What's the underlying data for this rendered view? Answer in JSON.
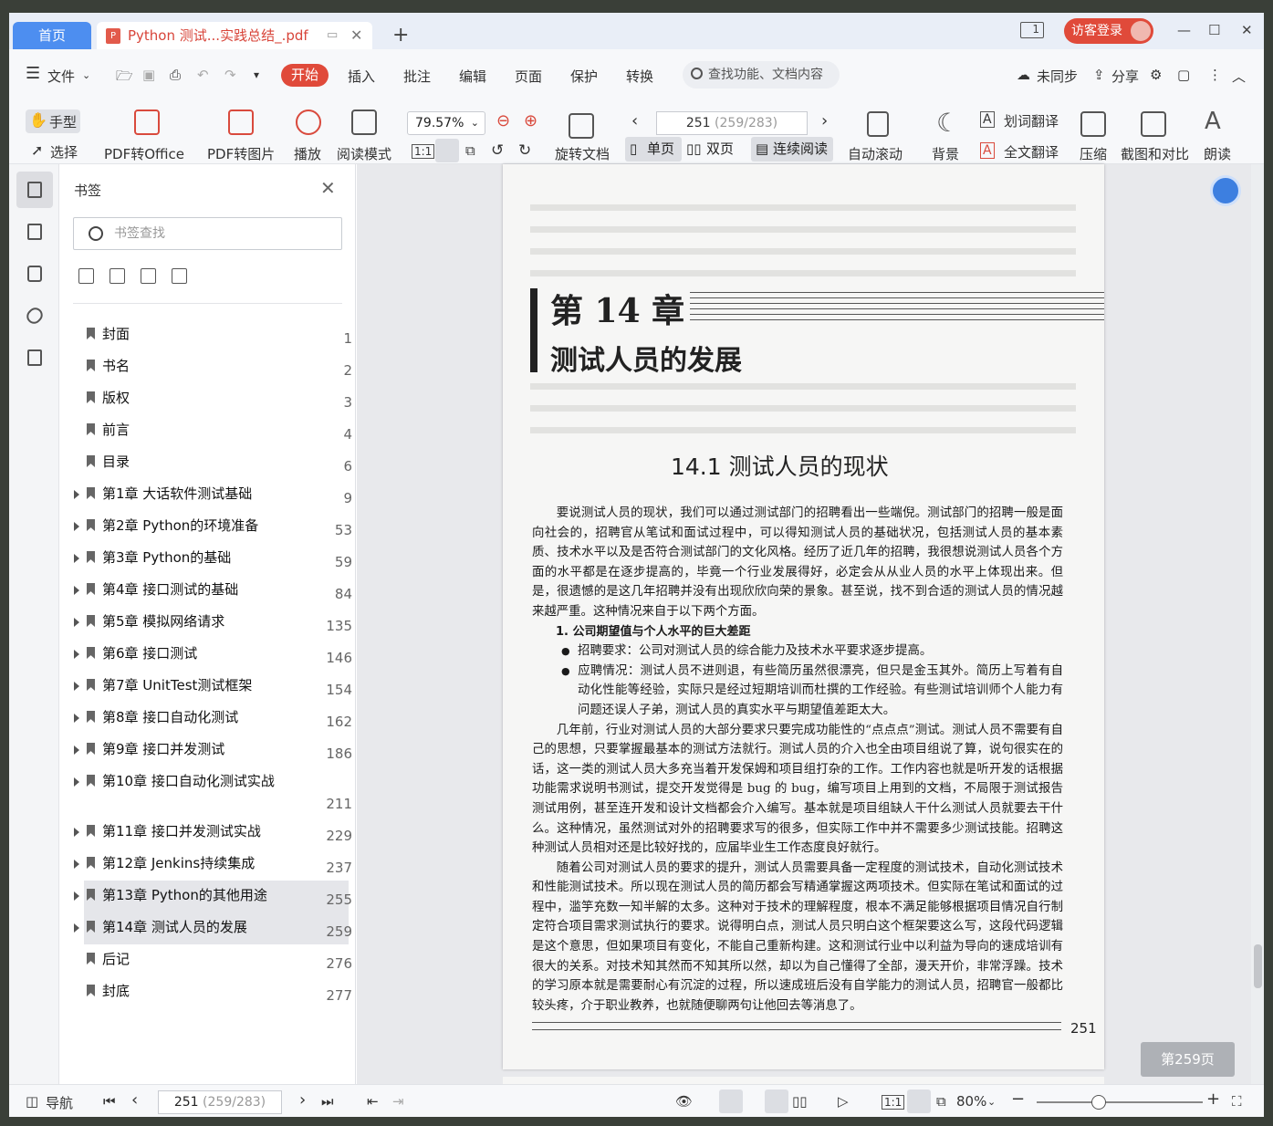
{
  "tabs": {
    "home": "首页",
    "doc_title": "Python 测试...实践总结_.pdf",
    "new_tab": "+"
  },
  "titlebar": {
    "pages_icon": "1",
    "login": "访客登录",
    "minimize": "—",
    "maximize": "☐",
    "close": "✕"
  },
  "menu": {
    "file": "文件",
    "items": [
      "开始",
      "插入",
      "批注",
      "编辑",
      "页面",
      "保护",
      "转换"
    ],
    "search": "查找功能、文档内容",
    "sync": "未同步",
    "share": "分享"
  },
  "toolbar": {
    "hand": "手型",
    "select": "选择",
    "pdf_office": "PDF转Office",
    "pdf_image": "PDF转图片",
    "play": "播放",
    "read_mode": "阅读模式",
    "zoom": "79.57%",
    "page_current": "251",
    "page_total": "(259/283)",
    "rotate": "旋转文档",
    "single": "单页",
    "double": "双页",
    "continuous": "连续阅读",
    "auto_scroll": "自动滚动",
    "background": "背景",
    "word_translate": "划词翻译",
    "full_translate": "全文翻译",
    "compress": "压缩",
    "screenshot": "截图和对比",
    "read_aloud": "朗读"
  },
  "bookmarks": {
    "title": "书签",
    "search_placeholder": "书签查找",
    "items": [
      {
        "label": "封面",
        "page": "1",
        "expandable": false
      },
      {
        "label": "书名",
        "page": "2",
        "expandable": false
      },
      {
        "label": "版权",
        "page": "3",
        "expandable": false
      },
      {
        "label": "前言",
        "page": "4",
        "expandable": false
      },
      {
        "label": "目录",
        "page": "6",
        "expandable": false
      },
      {
        "label": "第1章  大话软件测试基础",
        "page": "9",
        "expandable": true
      },
      {
        "label": "第2章  Python的环境准备",
        "page": "53",
        "expandable": true
      },
      {
        "label": "第3章  Python的基础",
        "page": "59",
        "expandable": true
      },
      {
        "label": "第4章  接口测试的基础",
        "page": "84",
        "expandable": true
      },
      {
        "label": "第5章  模拟网络请求",
        "page": "135",
        "expandable": true
      },
      {
        "label": "第6章  接口测试",
        "page": "146",
        "expandable": true
      },
      {
        "label": "第7章  UnitTest测试框架",
        "page": "154",
        "expandable": true
      },
      {
        "label": "第8章  接口自动化测试",
        "page": "162",
        "expandable": true
      },
      {
        "label": "第9章  接口并发测试",
        "page": "186",
        "expandable": true
      },
      {
        "label": "第10章  接口自动化测试实战",
        "page": "211",
        "expandable": true
      },
      {
        "label": "第11章  接口并发测试实战",
        "page": "229",
        "expandable": true
      },
      {
        "label": "第12章  Jenkins持续集成",
        "page": "237",
        "expandable": true
      },
      {
        "label": "第13章  Python的其他用途",
        "page": "255",
        "expandable": true
      },
      {
        "label": "第14章  测试人员的发展",
        "page": "259",
        "expandable": true
      },
      {
        "label": "后记",
        "page": "276",
        "expandable": false
      },
      {
        "label": "封底",
        "page": "277",
        "expandable": false
      }
    ]
  },
  "document": {
    "chapter_no": "第 14 章",
    "chapter_title": "测试人员的发展",
    "section": "14.1   测试人员的现状",
    "para1": "要说测试人员的现状，我们可以通过测试部门的招聘看出一些端倪。测试部门的招聘一般是面向社会的，招聘官从笔试和面试过程中，可以得知测试人员的基础状况，包括测试人员的基本素质、技术水平以及是否符合测试部门的文化风格。经历了近几年的招聘，我很想说测试人员各个方面的水平都是在逐步提高的，毕竟一个行业发展得好，必定会从从业人员的水平上体现出来。但是，很遗憾的是这几年招聘并没有出现欣欣向荣的景象。甚至说，找不到合适的测试人员的情况越来越严重。这种情况来自于以下两个方面。",
    "heading1": "1. 公司期望值与个人水平的巨大差距",
    "bullet1": "招聘要求：公司对测试人员的综合能力及技术水平要求逐步提高。",
    "bullet2": "应聘情况：测试人员不进则退，有些简历虽然很漂亮，但只是金玉其外。简历上写着有自动化性能等经验，实际只是经过短期培训而杜撰的工作经验。有些测试培训师个人能力有问题还误人子弟，测试人员的真实水平与期望值差距太大。",
    "para2": "几年前，行业对测试人员的大部分要求只要完成功能性的“点点点”测试。测试人员不需要有自己的思想，只要掌握最基本的测试方法就行。测试人员的介入也全由项目组说了算，说句很实在的话，这一类的测试人员大多充当着开发保姆和项目组打杂的工作。工作内容也就是听开发的话根据功能需求说明书测试，提交开发觉得是 bug 的 bug，编写项目上用到的文档，不局限于测试报告测试用例，甚至连开发和设计文档都会介入编写。基本就是项目组缺人干什么测试人员就要去干什么。这种情况，虽然测试对外的招聘要求写的很多，但实际工作中并不需要多少测试技能。招聘这种测试人员相对还是比较好找的，应届毕业生工作态度良好就行。",
    "para3": "随着公司对测试人员的要求的提升，测试人员需要具备一定程度的测试技术，自动化测试技术和性能测试技术。所以现在测试人员的简历都会写精通掌握这两项技术。但实际在笔试和面试的过程中，滥竽充数一知半解的太多。这种对于技术的理解程度，根本不满足能够根据项目情况自行制定符合项目需求测试执行的要求。说得明白点，测试人员只明白这个框架要这么写，这段代码逻辑是这个意思，但如果项目有变化，不能自己重新构建。这和测试行业中以利益为导向的速成培训有很大的关系。对技术知其然而不知其所以然，却以为自己懂得了全部，漫天开价，非常浮躁。技术的学习原本就是需要耐心有沉淀的过程，所以速成班后没有自学能力的测试人员，招聘官一般都比较头疼，介于职业教养，也就随便聊两句让他回去等消息了。",
    "page_number": "251",
    "page_badge": "第259页"
  },
  "status": {
    "nav": "导航",
    "page_current": "251",
    "page_total": "(259/283)",
    "zoom": "80%"
  }
}
